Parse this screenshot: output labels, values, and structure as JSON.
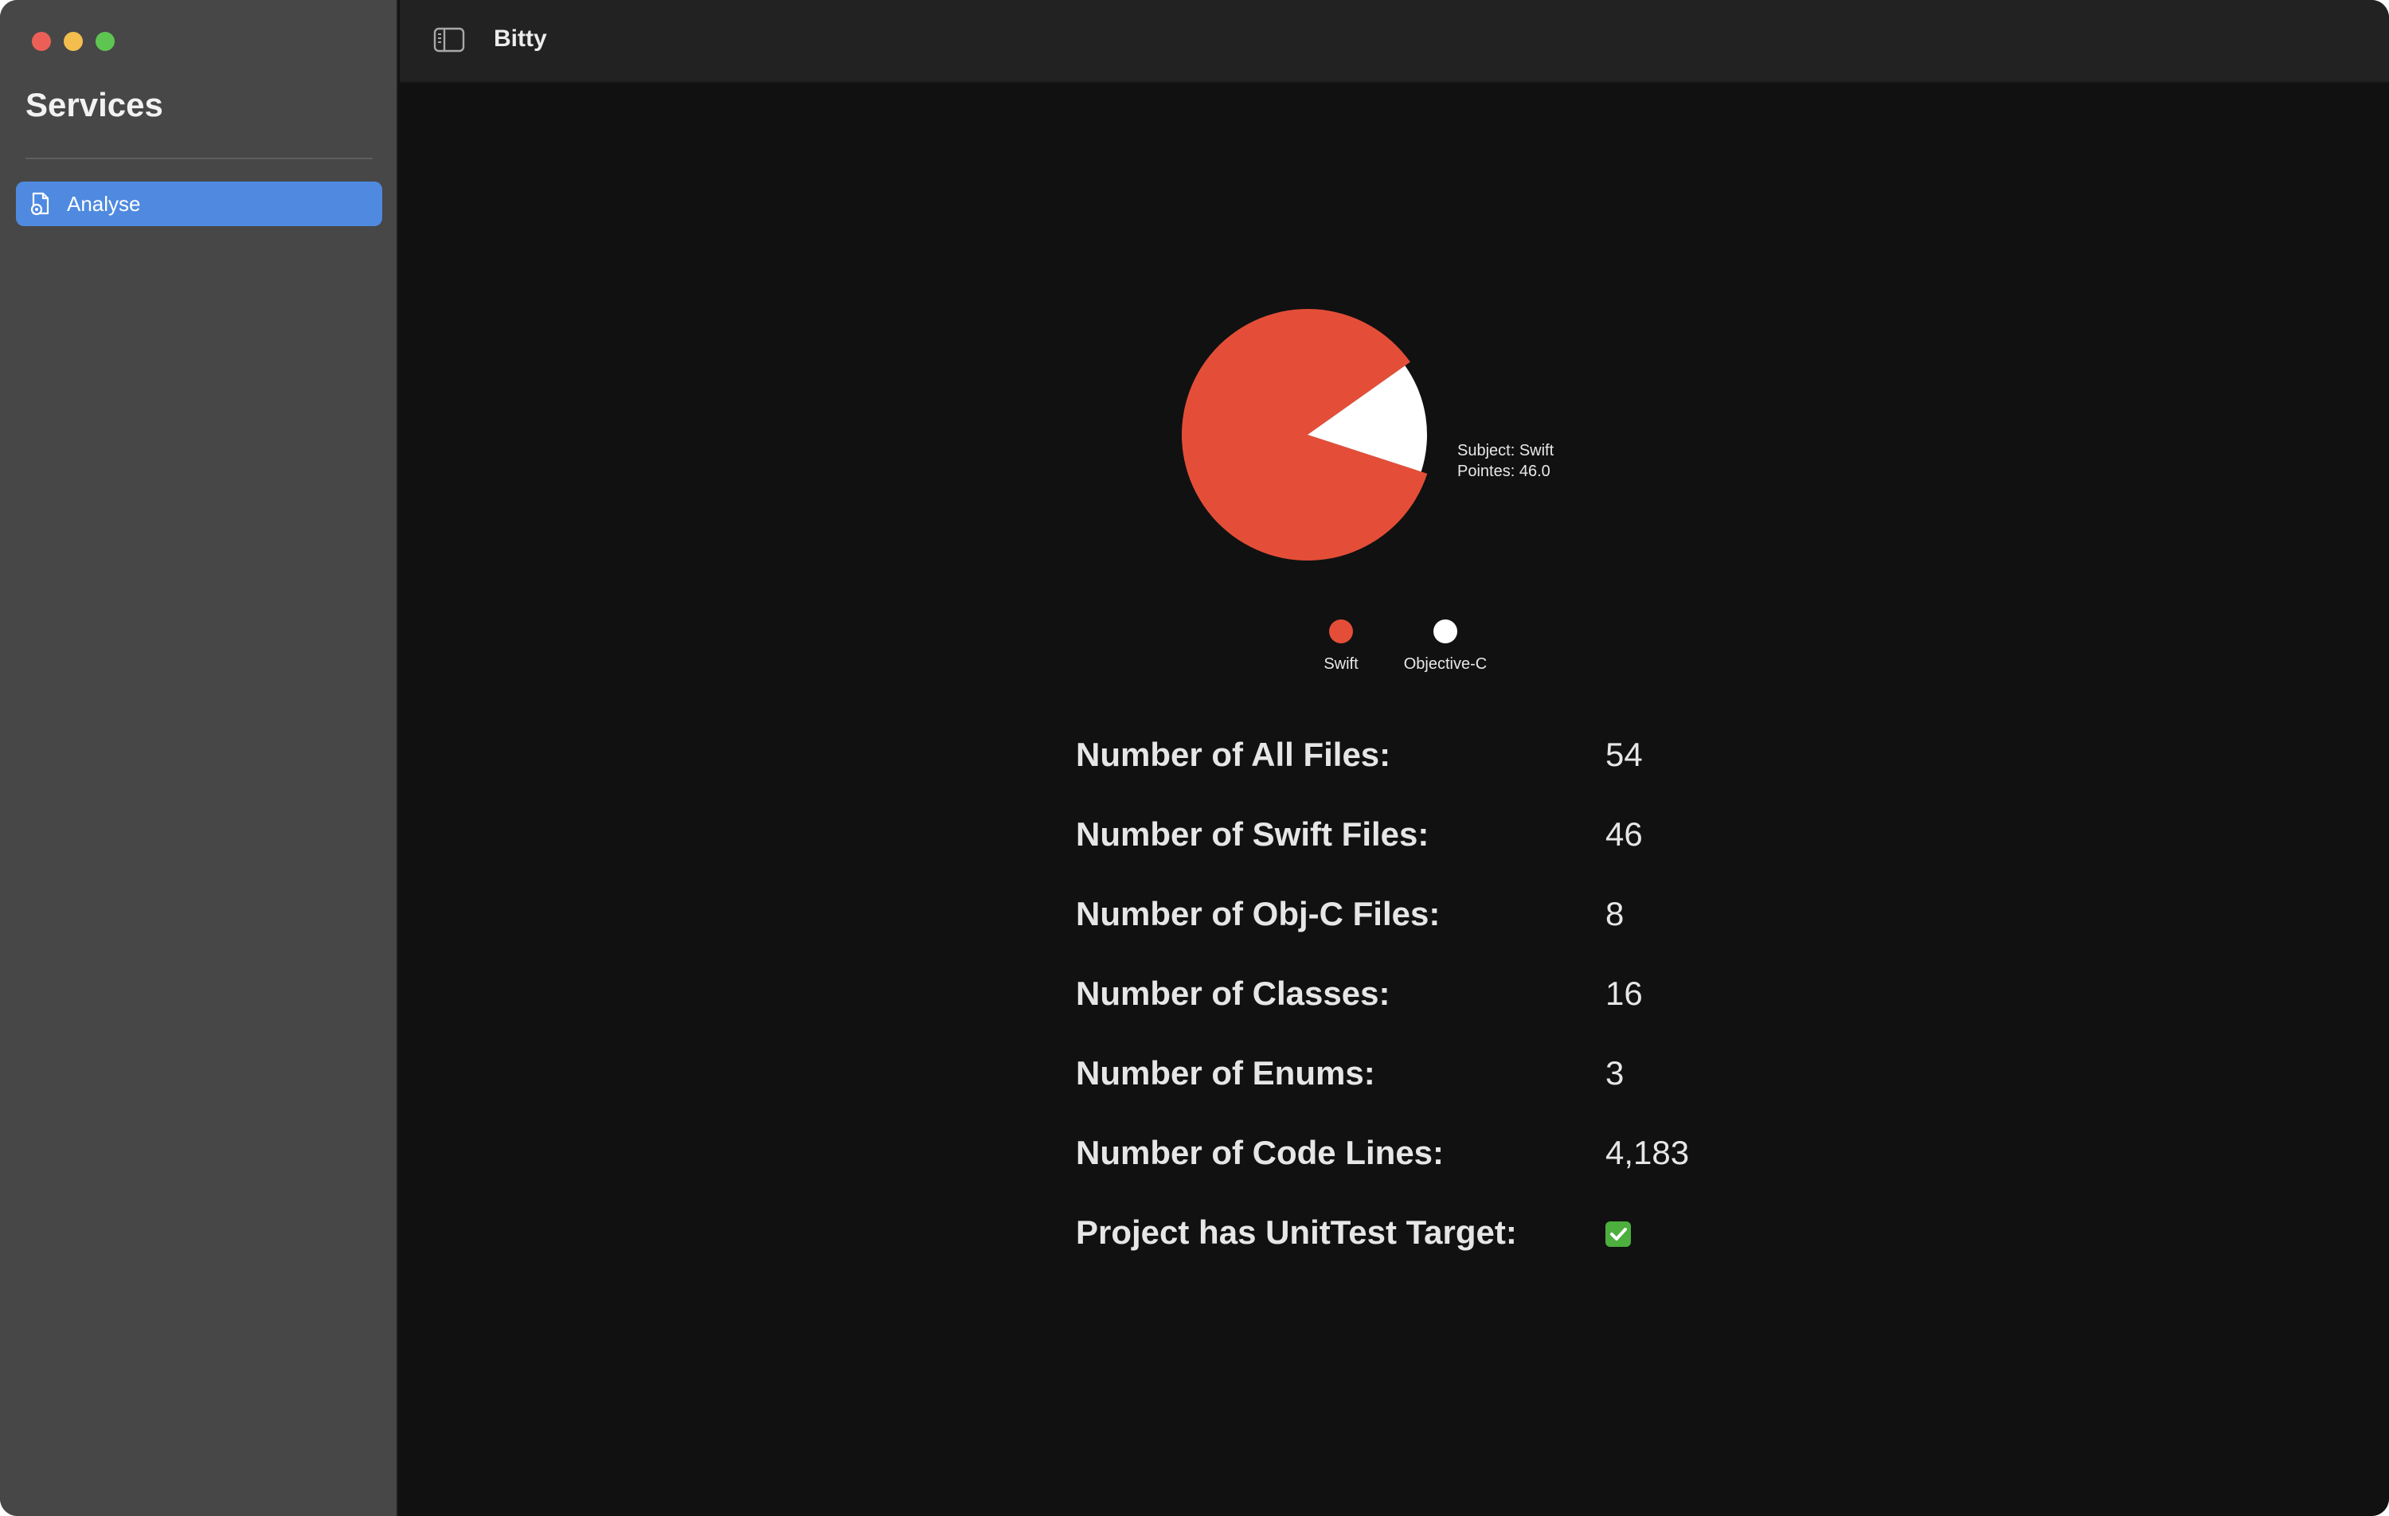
{
  "app": {
    "title": "Bitty"
  },
  "sidebar": {
    "title": "Services",
    "items": [
      {
        "label": "Analyse",
        "icon": "document-gear-icon",
        "selected": true
      }
    ]
  },
  "chart_data": {
    "type": "pie",
    "categories": [
      "Swift",
      "Objective-C"
    ],
    "values": [
      46,
      8
    ],
    "colors": [
      "#e44e38",
      "#ffffff"
    ],
    "legend": "bottom",
    "annotation": {
      "line1": "Subject: Swift",
      "line2": "Pointes: 46.0"
    }
  },
  "stats": [
    {
      "label": "Number of All Files:",
      "value": "54"
    },
    {
      "label": "Number of Swift Files:",
      "value": "46"
    },
    {
      "label": "Number of Obj-C Files:",
      "value": "8"
    },
    {
      "label": "Number of Classes:",
      "value": "16"
    },
    {
      "label": "Number of Enums:",
      "value": "3"
    },
    {
      "label": "Number of Code Lines:",
      "value": "4,183"
    },
    {
      "label": "Project has UnitTest Target:",
      "value": "",
      "icon": "checkmark-icon"
    }
  ],
  "colors": {
    "accent": "#4f8ae0",
    "sidebar": "#474747",
    "background": "#111111",
    "swift": "#e44e38"
  }
}
